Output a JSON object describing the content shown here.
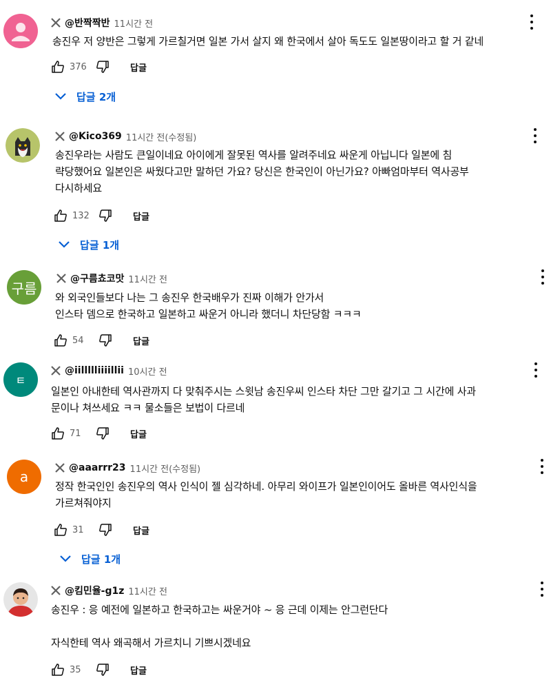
{
  "comments": [
    {
      "author": "@반짝짝반",
      "time": "11시간 전",
      "lines": [
        "송진우 저 양반은 그렇게 가르칠거면 일본 가서 살지 왜 한국에서 살아 독도도 일본땅이라고 할 거 같네"
      ],
      "likes": "376",
      "reply_label": "답글",
      "replies_label": "답글 2개",
      "avatar": {
        "kind": "default-user-icon",
        "color": "#f06292"
      }
    },
    {
      "author": "@Kico369",
      "time": "11시간 전(수정됨)",
      "lines": [
        "송진우라는  사람도  큰일이네요     아이에게 잘못된 역사를 알려주네요  싸운게  아닙니다 일본에  침",
        "략당했어요   일본인은   싸웠다고만 말하던 가요?  당신은 한국인이 아닌가요? 아빠엄마부터 역사공부",
        "다시하세요"
      ],
      "likes": "132",
      "reply_label": "답글",
      "replies_label": "답글 1개",
      "avatar": {
        "kind": "cat-photo-icon",
        "color": "#b7c46a"
      }
    },
    {
      "author": "@구름쵸코맛",
      "time": "11시간 전",
      "lines": [
        "와 외국인들보다 나는 그 송진우 한국배우가 진짜 이해가 안가서",
        "인스타 뎀으로 한국하고 일본하고 싸운거 아니라 했더니 차단당함 ㅋㅋㅋ"
      ],
      "likes": "54",
      "reply_label": "답글",
      "avatar": {
        "kind": "letter",
        "text": "구름",
        "color": "#689f38"
      }
    },
    {
      "author": "@iillllliiiillii",
      "time": "10시간 전",
      "lines": [
        "일본인 아내한테 역사관까지 다 맞춰주시는 스윗남 송진우씨 인스타 차단 그만 갈기고 그 시간에 사과",
        "문이나 쳐쓰세요 ㅋㅋ 물소들은 보법이 다르네"
      ],
      "likes": "71",
      "reply_label": "답글",
      "avatar": {
        "kind": "letter",
        "text": "ㅌ",
        "color": "#00897b"
      }
    },
    {
      "author": "@aaarrr23",
      "time": "11시간 전(수정됨)",
      "lines": [
        "정작 한국인인 송진우의 역사 인식이 젤 심각하네. 아무리 와이프가 일본인이어도 올바른 역사인식을",
        "가르쳐줘야지"
      ],
      "likes": "31",
      "reply_label": "답글",
      "replies_label": "답글 1개",
      "avatar": {
        "kind": "letter",
        "text": "a",
        "color": "#ef6c00"
      }
    },
    {
      "author": "@킴민율-g1z",
      "time": "11시간 전",
      "lines": [
        "송진우 : 응 예전에 일본하고 한국하고는 싸운거야 ~ 응 근데 이제는 안그런단다",
        "",
        "자식한테 역사 왜곡해서 가르치니 기쁘시겠네요"
      ],
      "likes": "35",
      "reply_label": "답글",
      "avatar": {
        "kind": "person-photo-icon",
        "color": "#d32f2f"
      }
    }
  ]
}
